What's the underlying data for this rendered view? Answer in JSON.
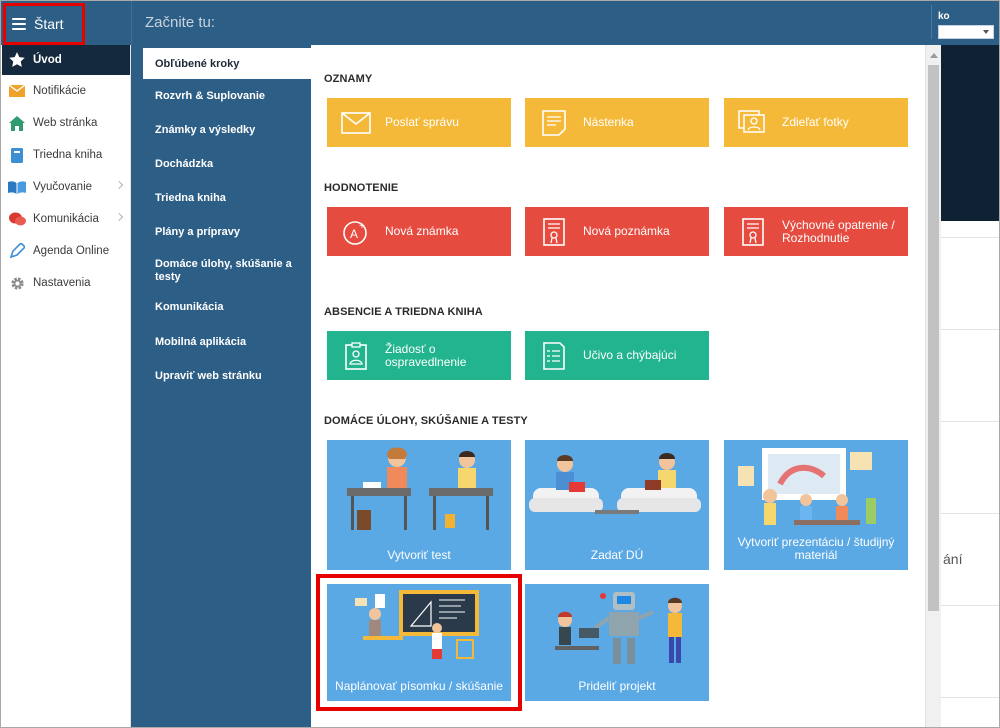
{
  "topbar": {
    "start_label": "Štart",
    "search_prompt": "Začnite tu:",
    "user_name_fragment": "ko"
  },
  "sidebar": {
    "items": [
      {
        "label": "Úvod",
        "icon": "star-icon"
      },
      {
        "label": "Notifikácie",
        "icon": "envelope-icon"
      },
      {
        "label": "Web stránka",
        "icon": "home-icon"
      },
      {
        "label": "Triedna kniha",
        "icon": "book-icon"
      },
      {
        "label": "Vyučovanie",
        "icon": "open-book-icon"
      },
      {
        "label": "Komunikácia",
        "icon": "chat-icon"
      },
      {
        "label": "Agenda Online",
        "icon": "pen-icon"
      },
      {
        "label": "Nastavenia",
        "icon": "gear-icon"
      }
    ]
  },
  "nav": {
    "items": [
      "Obľúbené kroky",
      "Rozvrh & Suplovanie",
      "Známky a výsledky",
      "Dochádzka",
      "Triedna kniha",
      "Plány a prípravy",
      "Domáce úlohy, skúšanie a testy",
      "Komunikácia",
      "Mobilná aplikácia",
      "Upraviť web stránku"
    ]
  },
  "sections": {
    "oznamy": {
      "title": "OZNAMY",
      "tiles": [
        "Poslať správu",
        "Nástenka",
        "Zdieľať fotky"
      ]
    },
    "hodnotenie": {
      "title": "HODNOTENIE",
      "tiles": [
        "Nová známka",
        "Nová poznámka",
        "Výchovné opatrenie / Rozhodnutie"
      ]
    },
    "absencie": {
      "title": "ABSENCIE A TRIEDNA KNIHA",
      "tiles": [
        "Žiadosť o ospravedlnenie",
        "Učivo a chýbajúci"
      ]
    },
    "domace": {
      "title": "DOMÁCE ÚLOHY, SKÚŠANIE A TESTY",
      "tiles": [
        "Vytvoriť test",
        "Zadať DÚ",
        "Vytvoriť prezentáciu / študijný materiál",
        "Naplánovať písomku / skúšanie",
        "Prideliť projekt"
      ]
    }
  },
  "background": {
    "text_fragment": "ání"
  },
  "colors": {
    "topbar": "#2d5e86",
    "yellow": "#f5b93a",
    "red": "#e54b3f",
    "green": "#21b48e",
    "picture_tile": "#5aa8e4",
    "highlight": "#e60000"
  }
}
